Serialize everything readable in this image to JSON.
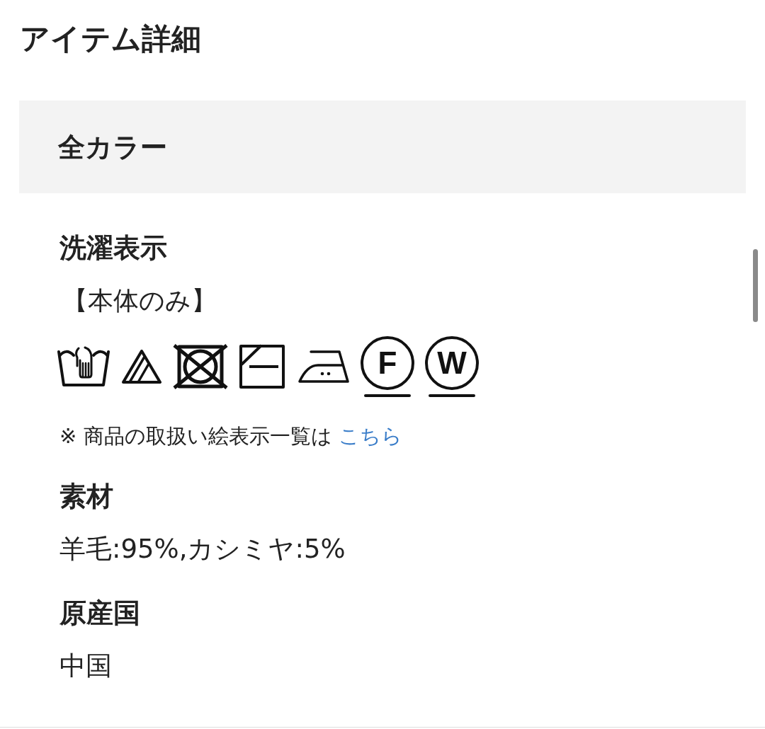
{
  "title": "アイテム詳細",
  "color_header": {
    "label": "全カラー"
  },
  "sections": [
    {
      "kind": "care",
      "heading": "洗濯表示",
      "scope": "【本体のみ】",
      "symbols": [
        {
          "kind": "hand-wash"
        },
        {
          "kind": "oxygen-bleach"
        },
        {
          "kind": "no-tumble-dry"
        },
        {
          "kind": "shade-flat-dry"
        },
        {
          "kind": "iron-medium"
        },
        {
          "kind": "dry-clean",
          "letter": "F"
        },
        {
          "kind": "wet-clean",
          "letter": "W"
        }
      ],
      "footnote": {
        "text": "※ 商品の取扱い絵表示一覧は",
        "link": "こちら"
      }
    },
    {
      "kind": "text",
      "heading": "素材",
      "value": "羊毛:95%,カシミヤ:5%"
    },
    {
      "kind": "text",
      "heading": "原産国",
      "value": "中国"
    }
  ]
}
